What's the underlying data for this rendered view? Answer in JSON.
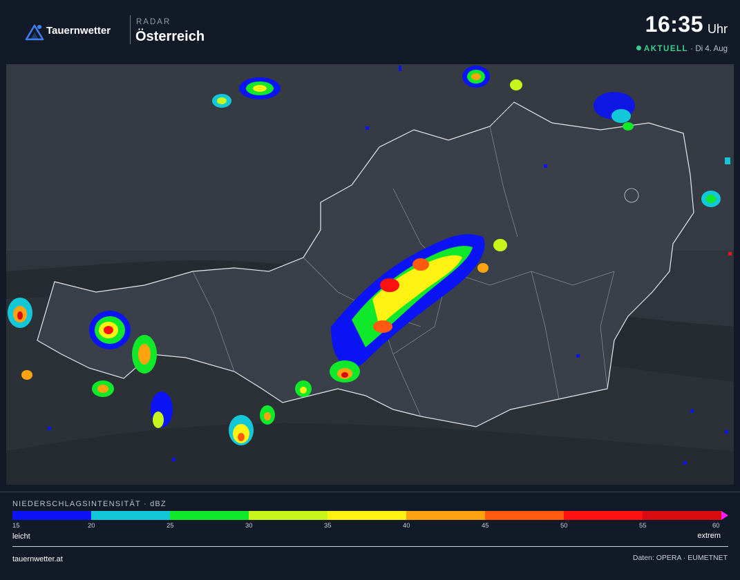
{
  "brand": {
    "name": "Tauernwetter",
    "icon": "mountain-icon",
    "accent": "#3b82f6"
  },
  "header": {
    "kicker": "RADAR",
    "region": "Österreich",
    "time": "16:35",
    "time_unit": "Uhr",
    "status_label": "AKTUELL",
    "status_date": "· Di 4. Aug",
    "status_color": "#3ecf8e"
  },
  "legend": {
    "title": "NIEDERSCHLAGSINTENSITÄT · dBZ",
    "low_label": "leicht",
    "high_label": "extrem",
    "ticks": [
      "15",
      "20",
      "25",
      "30",
      "35",
      "40",
      "45",
      "50",
      "55",
      "60"
    ],
    "colors": [
      "#0a14f5",
      "#12c8d8",
      "#10e82a",
      "#c8f51a",
      "#fff212",
      "#ffa410",
      "#ff5a10",
      "#ff1010",
      "#d80a12"
    ],
    "overflow_color": "#ff20f0"
  },
  "footer": {
    "site": "tauernwetter.at",
    "credits": "Daten: OPERA · EUMETNET"
  }
}
